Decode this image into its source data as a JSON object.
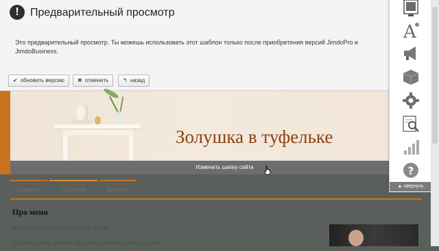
{
  "notice": {
    "icon": "exclamation-icon",
    "title": "Предварительный просмотр",
    "text": "Это предварительный просмотр. Ты можешь использовать этот шаблон только после приобретения версий JimdoPro и JimdoBusiness.",
    "buttons": {
      "update": "обновить версию",
      "cancel": "отменить",
      "back": "назад"
    }
  },
  "header": {
    "site_title": "Золушка в туфельке",
    "edit_header_label": "Изменить шапку сайта"
  },
  "nav": {
    "items": [
      "Главная",
      "Обо мне",
      "Контакт"
    ]
  },
  "about": {
    "title": "Про меня",
    "lines": [
      "Напиши тут про себя или свою фирму.",
      "Это всего лишь пример. Его можно изменить или удалить."
    ]
  },
  "toolbar": {
    "icons": [
      "layout-icon",
      "font-icon",
      "megaphone-icon",
      "box-icon",
      "settings-gear-icon",
      "statistics-search-icon",
      "stats-bars-icon",
      "help-icon"
    ],
    "collapse_label": "свернуть"
  },
  "colors": {
    "accent": "#c9731f",
    "title": "#8b4513",
    "page_bg": "#5a5f5b"
  }
}
